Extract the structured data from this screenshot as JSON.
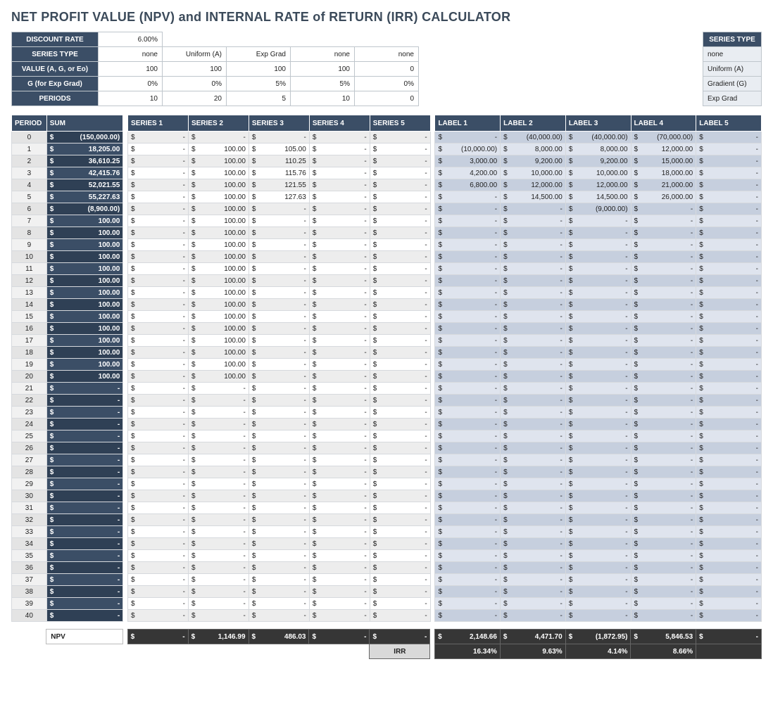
{
  "title": "NET PROFIT VALUE (NPV) and INTERNAL RATE of RETURN (IRR) CALCULATOR",
  "params": {
    "rows": [
      {
        "label": "DISCOUNT RATE",
        "values": [
          "6.00%"
        ]
      },
      {
        "label": "SERIES TYPE",
        "values": [
          "none",
          "Uniform (A)",
          "Exp Grad",
          "none",
          "none"
        ]
      },
      {
        "label": "VALUE (A, G, or Eo)",
        "values": [
          "100",
          "100",
          "100",
          "100",
          "0"
        ]
      },
      {
        "label": "G (for Exp Grad)",
        "values": [
          "0%",
          "0%",
          "5%",
          "5%",
          "0%"
        ]
      },
      {
        "label": "PERIODS",
        "values": [
          "10",
          "20",
          "5",
          "10",
          "0"
        ]
      }
    ],
    "legend_header": "SERIES TYPE",
    "legend": [
      "none",
      "Uniform (A)",
      "Gradient (G)",
      "Exp Grad"
    ]
  },
  "columns": {
    "period": "PERIOD",
    "sum": "SUM",
    "series": [
      "SERIES 1",
      "SERIES 2",
      "SERIES 3",
      "SERIES 4",
      "SERIES 5"
    ],
    "labels": [
      "LABEL 1",
      "LABEL 2",
      "LABEL 3",
      "LABEL 4",
      "LABEL 5"
    ]
  },
  "rows": [
    {
      "p": 0,
      "sum": "(150,000.00)",
      "s": [
        "-",
        "-",
        "-",
        "-",
        "-"
      ],
      "l": [
        "-",
        "(40,000.00)",
        "(40,000.00)",
        "(70,000.00)",
        "-"
      ]
    },
    {
      "p": 1,
      "sum": "18,205.00",
      "s": [
        "-",
        "100.00",
        "105.00",
        "-",
        "-"
      ],
      "l": [
        "(10,000.00)",
        "8,000.00",
        "8,000.00",
        "12,000.00",
        "-"
      ]
    },
    {
      "p": 2,
      "sum": "36,610.25",
      "s": [
        "-",
        "100.00",
        "110.25",
        "-",
        "-"
      ],
      "l": [
        "3,000.00",
        "9,200.00",
        "9,200.00",
        "15,000.00",
        "-"
      ]
    },
    {
      "p": 3,
      "sum": "42,415.76",
      "s": [
        "-",
        "100.00",
        "115.76",
        "-",
        "-"
      ],
      "l": [
        "4,200.00",
        "10,000.00",
        "10,000.00",
        "18,000.00",
        "-"
      ]
    },
    {
      "p": 4,
      "sum": "52,021.55",
      "s": [
        "-",
        "100.00",
        "121.55",
        "-",
        "-"
      ],
      "l": [
        "6,800.00",
        "12,000.00",
        "12,000.00",
        "21,000.00",
        "-"
      ]
    },
    {
      "p": 5,
      "sum": "55,227.63",
      "s": [
        "-",
        "100.00",
        "127.63",
        "-",
        "-"
      ],
      "l": [
        "-",
        "14,500.00",
        "14,500.00",
        "26,000.00",
        "-"
      ]
    },
    {
      "p": 6,
      "sum": "(8,900.00)",
      "s": [
        "-",
        "100.00",
        "-",
        "-",
        "-"
      ],
      "l": [
        "-",
        "-",
        "(9,000.00)",
        "-",
        "-"
      ]
    },
    {
      "p": 7,
      "sum": "100.00",
      "s": [
        "-",
        "100.00",
        "-",
        "-",
        "-"
      ],
      "l": [
        "-",
        "-",
        "-",
        "-",
        "-"
      ]
    },
    {
      "p": 8,
      "sum": "100.00",
      "s": [
        "-",
        "100.00",
        "-",
        "-",
        "-"
      ],
      "l": [
        "-",
        "-",
        "-",
        "-",
        "-"
      ]
    },
    {
      "p": 9,
      "sum": "100.00",
      "s": [
        "-",
        "100.00",
        "-",
        "-",
        "-"
      ],
      "l": [
        "-",
        "-",
        "-",
        "-",
        "-"
      ]
    },
    {
      "p": 10,
      "sum": "100.00",
      "s": [
        "-",
        "100.00",
        "-",
        "-",
        "-"
      ],
      "l": [
        "-",
        "-",
        "-",
        "-",
        "-"
      ]
    },
    {
      "p": 11,
      "sum": "100.00",
      "s": [
        "-",
        "100.00",
        "-",
        "-",
        "-"
      ],
      "l": [
        "-",
        "-",
        "-",
        "-",
        "-"
      ]
    },
    {
      "p": 12,
      "sum": "100.00",
      "s": [
        "-",
        "100.00",
        "-",
        "-",
        "-"
      ],
      "l": [
        "-",
        "-",
        "-",
        "-",
        "-"
      ]
    },
    {
      "p": 13,
      "sum": "100.00",
      "s": [
        "-",
        "100.00",
        "-",
        "-",
        "-"
      ],
      "l": [
        "-",
        "-",
        "-",
        "-",
        "-"
      ]
    },
    {
      "p": 14,
      "sum": "100.00",
      "s": [
        "-",
        "100.00",
        "-",
        "-",
        "-"
      ],
      "l": [
        "-",
        "-",
        "-",
        "-",
        "-"
      ]
    },
    {
      "p": 15,
      "sum": "100.00",
      "s": [
        "-",
        "100.00",
        "-",
        "-",
        "-"
      ],
      "l": [
        "-",
        "-",
        "-",
        "-",
        "-"
      ]
    },
    {
      "p": 16,
      "sum": "100.00",
      "s": [
        "-",
        "100.00",
        "-",
        "-",
        "-"
      ],
      "l": [
        "-",
        "-",
        "-",
        "-",
        "-"
      ]
    },
    {
      "p": 17,
      "sum": "100.00",
      "s": [
        "-",
        "100.00",
        "-",
        "-",
        "-"
      ],
      "l": [
        "-",
        "-",
        "-",
        "-",
        "-"
      ]
    },
    {
      "p": 18,
      "sum": "100.00",
      "s": [
        "-",
        "100.00",
        "-",
        "-",
        "-"
      ],
      "l": [
        "-",
        "-",
        "-",
        "-",
        "-"
      ]
    },
    {
      "p": 19,
      "sum": "100.00",
      "s": [
        "-",
        "100.00",
        "-",
        "-",
        "-"
      ],
      "l": [
        "-",
        "-",
        "-",
        "-",
        "-"
      ]
    },
    {
      "p": 20,
      "sum": "100.00",
      "s": [
        "-",
        "100.00",
        "-",
        "-",
        "-"
      ],
      "l": [
        "-",
        "-",
        "-",
        "-",
        "-"
      ]
    },
    {
      "p": 21,
      "sum": "-",
      "s": [
        "-",
        "-",
        "-",
        "-",
        "-"
      ],
      "l": [
        "-",
        "-",
        "-",
        "-",
        "-"
      ]
    },
    {
      "p": 22,
      "sum": "-",
      "s": [
        "-",
        "-",
        "-",
        "-",
        "-"
      ],
      "l": [
        "-",
        "-",
        "-",
        "-",
        "-"
      ]
    },
    {
      "p": 23,
      "sum": "-",
      "s": [
        "-",
        "-",
        "-",
        "-",
        "-"
      ],
      "l": [
        "-",
        "-",
        "-",
        "-",
        "-"
      ]
    },
    {
      "p": 24,
      "sum": "-",
      "s": [
        "-",
        "-",
        "-",
        "-",
        "-"
      ],
      "l": [
        "-",
        "-",
        "-",
        "-",
        "-"
      ]
    },
    {
      "p": 25,
      "sum": "-",
      "s": [
        "-",
        "-",
        "-",
        "-",
        "-"
      ],
      "l": [
        "-",
        "-",
        "-",
        "-",
        "-"
      ]
    },
    {
      "p": 26,
      "sum": "-",
      "s": [
        "-",
        "-",
        "-",
        "-",
        "-"
      ],
      "l": [
        "-",
        "-",
        "-",
        "-",
        "-"
      ]
    },
    {
      "p": 27,
      "sum": "-",
      "s": [
        "-",
        "-",
        "-",
        "-",
        "-"
      ],
      "l": [
        "-",
        "-",
        "-",
        "-",
        "-"
      ]
    },
    {
      "p": 28,
      "sum": "-",
      "s": [
        "-",
        "-",
        "-",
        "-",
        "-"
      ],
      "l": [
        "-",
        "-",
        "-",
        "-",
        "-"
      ]
    },
    {
      "p": 29,
      "sum": "-",
      "s": [
        "-",
        "-",
        "-",
        "-",
        "-"
      ],
      "l": [
        "-",
        "-",
        "-",
        "-",
        "-"
      ]
    },
    {
      "p": 30,
      "sum": "-",
      "s": [
        "-",
        "-",
        "-",
        "-",
        "-"
      ],
      "l": [
        "-",
        "-",
        "-",
        "-",
        "-"
      ]
    },
    {
      "p": 31,
      "sum": "-",
      "s": [
        "-",
        "-",
        "-",
        "-",
        "-"
      ],
      "l": [
        "-",
        "-",
        "-",
        "-",
        "-"
      ]
    },
    {
      "p": 32,
      "sum": "-",
      "s": [
        "-",
        "-",
        "-",
        "-",
        "-"
      ],
      "l": [
        "-",
        "-",
        "-",
        "-",
        "-"
      ]
    },
    {
      "p": 33,
      "sum": "-",
      "s": [
        "-",
        "-",
        "-",
        "-",
        "-"
      ],
      "l": [
        "-",
        "-",
        "-",
        "-",
        "-"
      ]
    },
    {
      "p": 34,
      "sum": "-",
      "s": [
        "-",
        "-",
        "-",
        "-",
        "-"
      ],
      "l": [
        "-",
        "-",
        "-",
        "-",
        "-"
      ]
    },
    {
      "p": 35,
      "sum": "-",
      "s": [
        "-",
        "-",
        "-",
        "-",
        "-"
      ],
      "l": [
        "-",
        "-",
        "-",
        "-",
        "-"
      ]
    },
    {
      "p": 36,
      "sum": "-",
      "s": [
        "-",
        "-",
        "-",
        "-",
        "-"
      ],
      "l": [
        "-",
        "-",
        "-",
        "-",
        "-"
      ]
    },
    {
      "p": 37,
      "sum": "-",
      "s": [
        "-",
        "-",
        "-",
        "-",
        "-"
      ],
      "l": [
        "-",
        "-",
        "-",
        "-",
        "-"
      ]
    },
    {
      "p": 38,
      "sum": "-",
      "s": [
        "-",
        "-",
        "-",
        "-",
        "-"
      ],
      "l": [
        "-",
        "-",
        "-",
        "-",
        "-"
      ]
    },
    {
      "p": 39,
      "sum": "-",
      "s": [
        "-",
        "-",
        "-",
        "-",
        "-"
      ],
      "l": [
        "-",
        "-",
        "-",
        "-",
        "-"
      ]
    },
    {
      "p": 40,
      "sum": "-",
      "s": [
        "-",
        "-",
        "-",
        "-",
        "-"
      ],
      "l": [
        "-",
        "-",
        "-",
        "-",
        "-"
      ]
    }
  ],
  "footer": {
    "npv_label": "NPV",
    "npv_sum": "-",
    "npv_series": [
      "-",
      "1,146.99",
      "486.03",
      "-",
      "-"
    ],
    "npv_labels": [
      "2,148.66",
      "4,471.70",
      "(1,872.95)",
      "5,846.53",
      "-"
    ],
    "irr_label": "IRR",
    "irr_values": [
      "16.34%",
      "9.63%",
      "4.14%",
      "8.66%",
      ""
    ]
  }
}
